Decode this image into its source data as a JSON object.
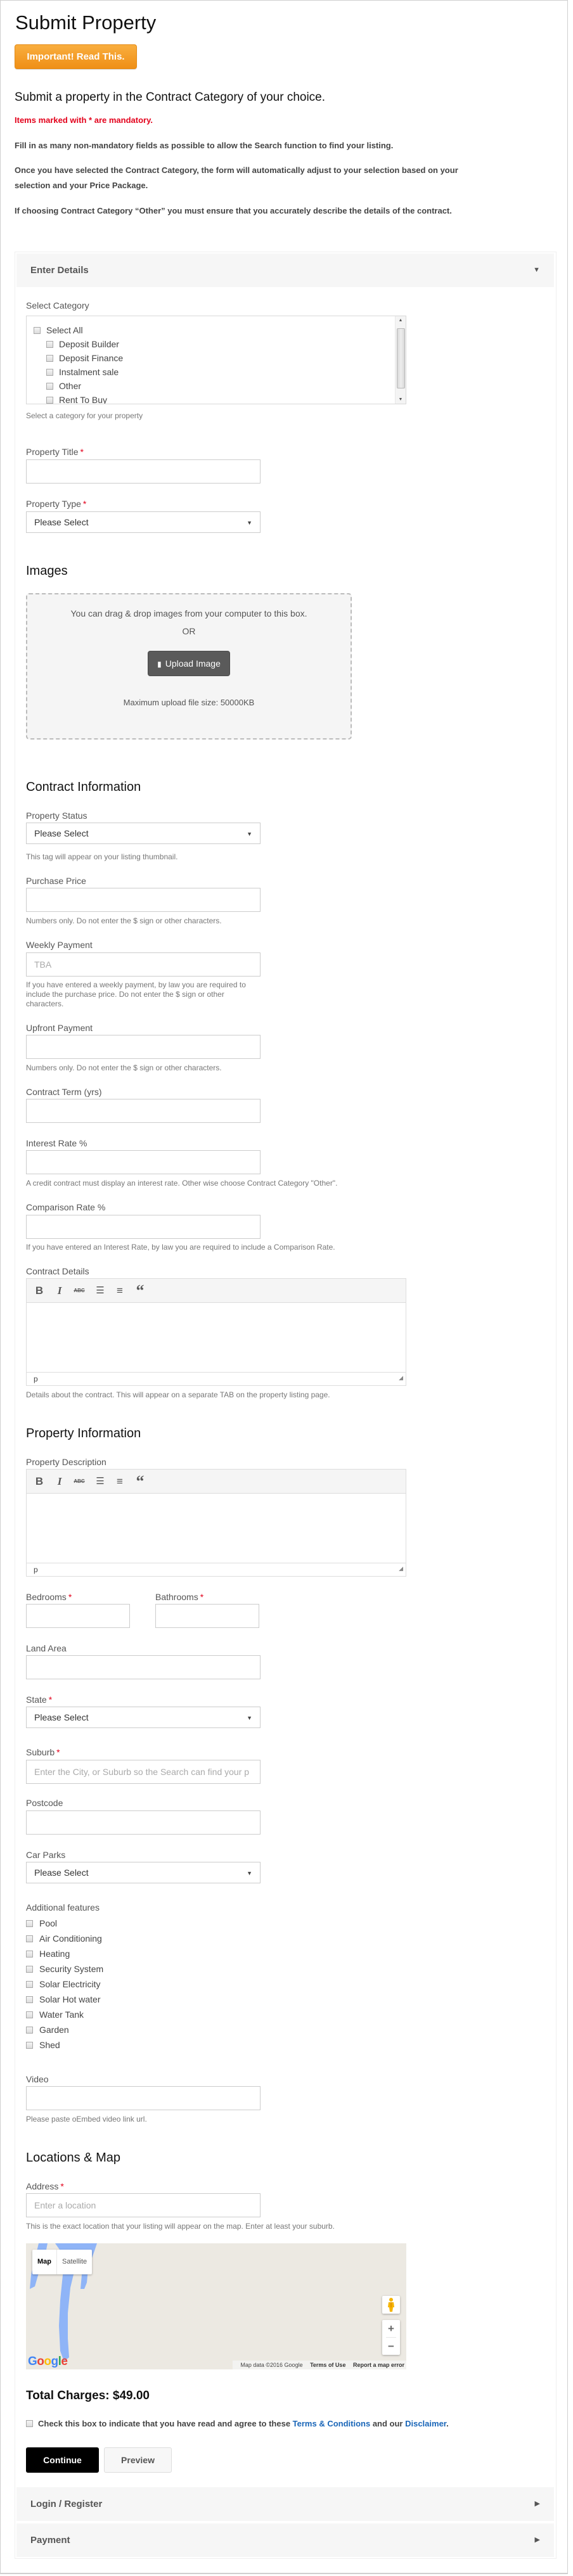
{
  "page": {
    "title": "Submit Property",
    "important_button": "Important! Read This.",
    "subtitle": "Submit a property in the Contract Category of your choice.",
    "mandatory_note": "Items marked with * are mandatory.",
    "paragraphs": [
      "Fill in as many non-mandatory fields as possible to allow the Search function to find your listing.",
      "Once you have selected the Contract Category, the form will automatically adjust to your selection based on your",
      "selection and your Price Package.",
      "If choosing Contract Category “Other” you must ensure that you accurately describe the details of the contract."
    ]
  },
  "accordion": {
    "enter_details": "Enter Details",
    "login_register": "Login / Register",
    "payment": "Payment"
  },
  "category": {
    "label": "Select Category",
    "select_all": "Select All",
    "options": [
      "Deposit Builder",
      "Deposit Finance",
      "Instalment sale",
      "Other",
      "Rent To Buy"
    ],
    "hint": "Select a category for your property"
  },
  "property_title": {
    "label": "Property Title",
    "value": ""
  },
  "property_type": {
    "label": "Property Type",
    "selected": "Please Select"
  },
  "images": {
    "heading": "Images",
    "drag_text": "You can drag & drop images from your computer to this box.",
    "or_text": "OR",
    "upload_button": "Upload Image",
    "max_size": "Maximum upload file size: 50000KB"
  },
  "contract": {
    "heading": "Contract Information",
    "property_status": {
      "label": "Property Status",
      "selected": "Please Select",
      "hint": "This tag will appear on your listing thumbnail."
    },
    "purchase_price": {
      "label": "Purchase Price",
      "value": "",
      "hint": "Numbers only. Do not enter the $ sign or other characters."
    },
    "weekly_payment": {
      "label": "Weekly Payment",
      "placeholder": "TBA",
      "hint_lines": [
        "If you have entered a weekly payment, by law you are required to",
        "include the purchase price. Do not enter the $ sign or other",
        "characters."
      ]
    },
    "upfront_payment": {
      "label": "Upfront Payment",
      "value": "",
      "hint": "Numbers only. Do not enter the $ sign or other characters."
    },
    "contract_term": {
      "label": "Contract Term (yrs)",
      "value": ""
    },
    "interest_rate": {
      "label": "Interest Rate %",
      "value": "",
      "hint": "A credit contract must display an interest rate. Other wise choose Contract Category \"Other\"."
    },
    "comparison_rate": {
      "label": "Comparison Rate %",
      "value": "",
      "hint": "If you have entered an Interest Rate, by law you are required to include a Comparison Rate."
    },
    "contract_details": {
      "label": "Contract Details",
      "status_path": "p",
      "hint": "Details about the contract. This will appear on a separate TAB on the property listing page."
    }
  },
  "editor_toolbar": {
    "bold": "B",
    "italic": "I",
    "strike": "ABC",
    "bullet_list": "☰",
    "numbered_list": "≡",
    "quote": "“"
  },
  "property_info": {
    "heading": "Property Information",
    "description": {
      "label": "Property Description",
      "status_path": "p"
    },
    "bedrooms": {
      "label": "Bedrooms",
      "value": ""
    },
    "bathrooms": {
      "label": "Bathrooms",
      "value": ""
    },
    "land_area": {
      "label": "Land Area",
      "value": ""
    },
    "state": {
      "label": "State",
      "selected": "Please Select"
    },
    "suburb": {
      "label": "Suburb",
      "placeholder": "Enter the City, or Suburb so the Search can find your p"
    },
    "postcode": {
      "label": "Postcode",
      "value": ""
    },
    "car_parks": {
      "label": "Car Parks",
      "selected": "Please Select"
    },
    "features_label": "Additional features",
    "features": [
      "Pool",
      "Air Conditioning",
      "Heating",
      "Security System",
      "Solar Electricity",
      "Solar Hot water",
      "Water Tank",
      "Garden",
      "Shed"
    ],
    "video": {
      "label": "Video",
      "value": "",
      "hint": "Please paste oEmbed video link url."
    }
  },
  "location": {
    "heading": "Locations & Map",
    "address": {
      "label": "Address",
      "placeholder": "Enter a location",
      "hint": "This is the exact location that your listing will appear on the map. Enter at least your suburb."
    },
    "map": {
      "type_map": "Map",
      "type_satellite": "Satellite",
      "zoom_in": "+",
      "zoom_out": "−",
      "google_logo": [
        "G",
        "o",
        "o",
        "g",
        "l",
        "e"
      ],
      "google_colors": [
        "#4285f4",
        "#ea4335",
        "#fbbc05",
        "#4285f4",
        "#34a853",
        "#ea4335"
      ],
      "map_data": "Map data ©2016 Google",
      "terms": "Terms of Use",
      "report": "Report a map error"
    }
  },
  "checkout": {
    "total_label": "Total Charges: $49.00",
    "agree_text": "Check this box to indicate that you have read and agree to these ",
    "terms_link": "Terms & Conditions",
    "and_our": " and our ",
    "disclaimer_link": "Disclaimer",
    "period": ".",
    "continue_button": "Continue",
    "preview_button": "Preview"
  },
  "colors": {
    "accent_orange": "#f39c1f",
    "required_red": "#e3001b",
    "link_blue": "#1a66b8"
  }
}
